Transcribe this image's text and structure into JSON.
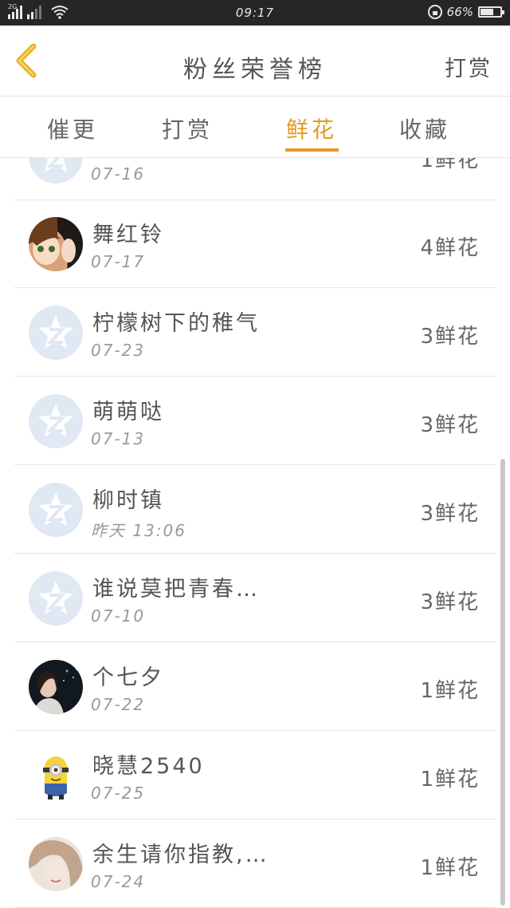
{
  "status_bar": {
    "network": "2G",
    "time": "09:17",
    "battery": "66%",
    "battery_level": 0.66
  },
  "header": {
    "title": "粉丝荣誉榜",
    "action": "打赏"
  },
  "tabs": [
    {
      "label": "催更",
      "active": false
    },
    {
      "label": "打赏",
      "active": false
    },
    {
      "label": "鲜花",
      "active": true
    },
    {
      "label": "收藏",
      "active": false
    }
  ],
  "list": {
    "items": [
      {
        "name": "",
        "date": "07-16",
        "amount": "1鲜花",
        "avatar": "qq-default-avatar"
      },
      {
        "name": "舞红铃",
        "date": "07-17",
        "amount": "4鲜花",
        "avatar": "anime-avatar"
      },
      {
        "name": "柠檬树下的稚气",
        "date": "07-23",
        "amount": "3鲜花",
        "avatar": "qq-default-avatar"
      },
      {
        "name": "萌萌哒",
        "date": "07-13",
        "amount": "3鲜花",
        "avatar": "qq-default-avatar"
      },
      {
        "name": "柳时镇",
        "date": "昨天 13:06",
        "amount": "3鲜花",
        "avatar": "qq-default-avatar"
      },
      {
        "name": "谁说莫把青春…",
        "date": "07-10",
        "amount": "3鲜花",
        "avatar": "qq-default-avatar"
      },
      {
        "name": "个七夕",
        "date": "07-22",
        "amount": "1鲜花",
        "avatar": "photo-avatar-dark"
      },
      {
        "name": "晓慧2540",
        "date": "07-25",
        "amount": "1鲜花",
        "avatar": "minion-avatar"
      },
      {
        "name": "余生请你指教,…",
        "date": "07-24",
        "amount": "1鲜花",
        "avatar": "photo-avatar-light"
      }
    ]
  },
  "colors": {
    "accent": "#e59a1e",
    "back_arrow": "#e8b21c",
    "default_avatar_bg": "#dfe8f3",
    "status_bar_bg": "#262626"
  }
}
